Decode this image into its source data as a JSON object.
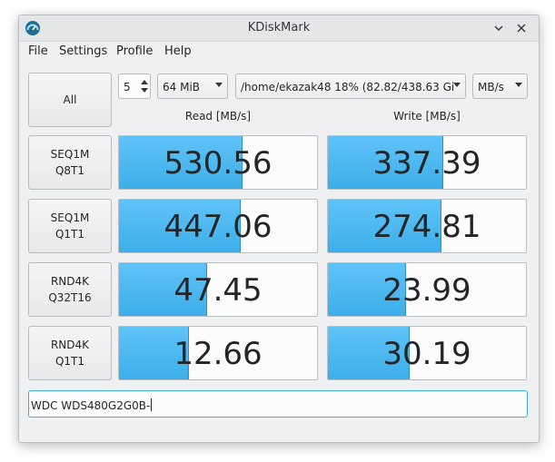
{
  "window": {
    "title": "KDiskMark"
  },
  "menu": [
    "File",
    "Settings",
    "Profile",
    "Help"
  ],
  "controls": {
    "all_label": "All",
    "loops": "5",
    "size": "64 MiB",
    "path": "/home/ekazak48 18% (82.82/438.63 Gi",
    "units": "MB/s"
  },
  "headers": {
    "read": "Read [MB/s]",
    "write": "Write [MB/s]"
  },
  "tests": [
    {
      "line1": "SEQ1M",
      "line2": "Q8T1",
      "read": "530.56",
      "write": "337.39",
      "read_fill": 0.62,
      "write_fill": 0.58
    },
    {
      "line1": "SEQ1M",
      "line2": "Q1T1",
      "read": "447.06",
      "write": "274.81",
      "read_fill": 0.61,
      "write_fill": 0.57
    },
    {
      "line1": "RND4K",
      "line2": "Q32T16",
      "read": "47.45",
      "write": "23.99",
      "read_fill": 0.44,
      "write_fill": 0.39
    },
    {
      "line1": "RND4K",
      "line2": "Q1T1",
      "read": "12.66",
      "write": "30.19",
      "read_fill": 0.35,
      "write_fill": 0.41
    }
  ],
  "device_name": "WDC WDS480G2G0B-",
  "colors": {
    "accent": "#3daee9",
    "bar": "#5fc3f7"
  },
  "icons": {
    "app": "kdiskmark-gauge-icon",
    "collapse": "chevron-down-icon",
    "close": "close-icon"
  }
}
